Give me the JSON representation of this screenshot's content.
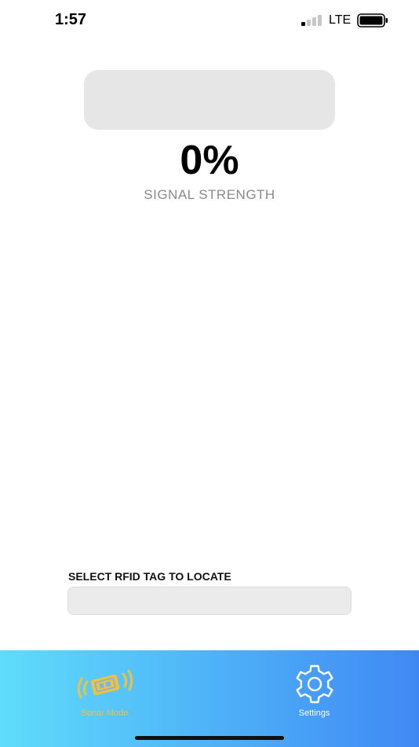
{
  "status_bar": {
    "time": "1:57",
    "network": "LTE"
  },
  "meter": {
    "level": 0,
    "percent_text": "0%",
    "label": "SIGNAL STRENGTH",
    "fill_color": "#3d8bf4"
  },
  "tag_select": {
    "label": "SELECT RFID TAG TO LOCATE",
    "value": ""
  },
  "tab_bar": {
    "tabs": [
      {
        "label": "Sonar Mode",
        "icon": "sonar-rfid-icon",
        "active": true
      },
      {
        "label": "Settings",
        "icon": "gear-icon",
        "active": false
      }
    ],
    "active_color": "#f0c040",
    "inactive_color": "#ffffff"
  }
}
